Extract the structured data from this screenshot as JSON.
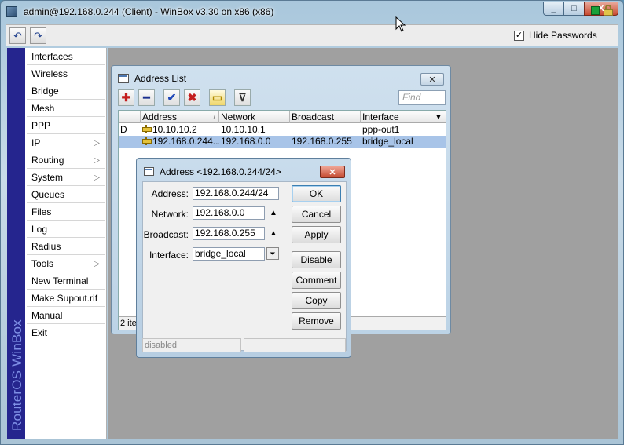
{
  "window": {
    "title": "admin@192.168.0.244 (Client) - WinBox v3.30 on x86 (x86)",
    "minimize_glyph": "_",
    "maximize_glyph": "□",
    "close_glyph": "X"
  },
  "toolbar": {
    "undo_glyph": "↶",
    "redo_glyph": "↷",
    "hide_passwords_label": "Hide Passwords",
    "hide_passwords_checked": true,
    "check_glyph": "✓"
  },
  "sidebar": {
    "brand": "RouterOS WinBox",
    "items": [
      {
        "label": "Interfaces",
        "submenu": false
      },
      {
        "label": "Wireless",
        "submenu": false
      },
      {
        "label": "Bridge",
        "submenu": false
      },
      {
        "label": "Mesh",
        "submenu": false
      },
      {
        "label": "PPP",
        "submenu": false
      },
      {
        "label": "IP",
        "submenu": true
      },
      {
        "label": "Routing",
        "submenu": true
      },
      {
        "label": "System",
        "submenu": true
      },
      {
        "label": "Queues",
        "submenu": false
      },
      {
        "label": "Files",
        "submenu": false
      },
      {
        "label": "Log",
        "submenu": false
      },
      {
        "label": "Radius",
        "submenu": false
      },
      {
        "label": "Tools",
        "submenu": true
      },
      {
        "label": "New Terminal",
        "submenu": false
      },
      {
        "label": "Make Supout.rif",
        "submenu": false
      },
      {
        "label": "Manual",
        "submenu": false
      },
      {
        "label": "Exit",
        "submenu": false
      }
    ],
    "submenu_glyph": "▷"
  },
  "address_list": {
    "title": "Address List",
    "close_glyph": "✕",
    "find_placeholder": "Find",
    "tools": {
      "add": "✚",
      "remove": "━",
      "enable": "✔",
      "disable": "✖",
      "comment": "▭",
      "filter": "⊽"
    },
    "columns": [
      "Address",
      "Network",
      "Broadcast",
      "Interface"
    ],
    "sort_glyph": "/",
    "menu_glyph": "▼",
    "rows": [
      {
        "flag": "D",
        "address": "10.10.10.2",
        "network": "10.10.10.1",
        "broadcast": "",
        "interface": "ppp-out1",
        "selected": false
      },
      {
        "flag": "",
        "address": "192.168.0.244...",
        "network": "192.168.0.0",
        "broadcast": "192.168.0.255",
        "interface": "bridge_local",
        "selected": true
      }
    ],
    "status": "2 items"
  },
  "address_dialog": {
    "title": "Address <192.168.0.244/24>",
    "close_glyph": "✕",
    "fields": {
      "address_label": "Address:",
      "address_value": "192.168.0.244/24",
      "network_label": "Network:",
      "network_value": "192.168.0.0",
      "broadcast_label": "Broadcast:",
      "broadcast_value": "192.168.0.255",
      "interface_label": "Interface:",
      "interface_value": "bridge_local"
    },
    "arrow_up_glyph": "▲",
    "dropdown_glyph": "⏷",
    "buttons": {
      "ok": "OK",
      "cancel": "Cancel",
      "apply": "Apply",
      "disable": "Disable",
      "comment": "Comment",
      "copy": "Copy",
      "remove": "Remove"
    },
    "status": "disabled"
  }
}
